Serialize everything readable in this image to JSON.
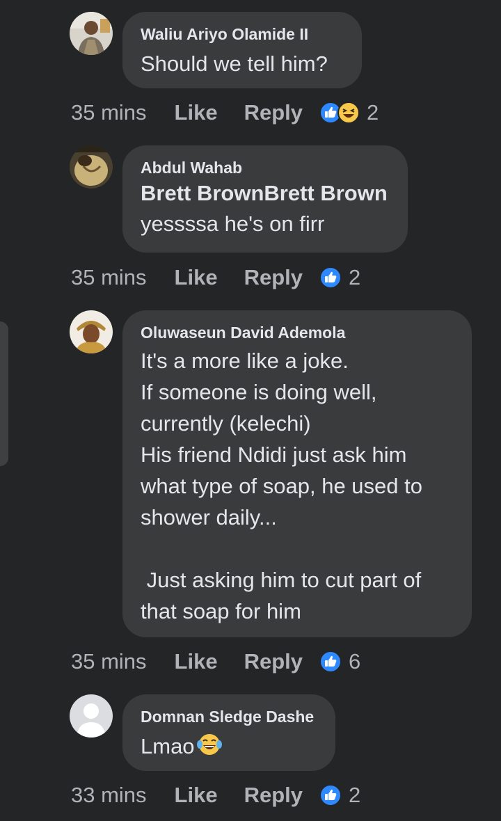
{
  "colors": {
    "background": "#242526",
    "bubble": "#3a3b3c",
    "text": "#e4e6eb",
    "secondary_text": "#b0b3b8",
    "like_blue": "#2e89ff"
  },
  "comments": [
    {
      "author": "Waliu Ariyo Olamide II",
      "text": "Should we tell him?",
      "time": "35 mins",
      "like_label": "Like",
      "reply_label": "Reply",
      "reactions": [
        "like-icon",
        "haha-icon"
      ],
      "reaction_count": "2"
    },
    {
      "author": "Abdul Wahab",
      "tag": "Brett BrownBrett Brown",
      "text": "yessssa he's on firr",
      "time": "35 mins",
      "like_label": "Like",
      "reply_label": "Reply",
      "reactions": [
        "like-icon"
      ],
      "reaction_count": "2"
    },
    {
      "author": "Oluwaseun David Ademola",
      "text": "It's a more like a joke.\nIf someone is doing well,\ncurrently (kelechi)\nHis friend Ndidi just ask him\nwhat type of soap, he used to\nshower daily...\n\n Just asking him to cut part of\nthat soap for him",
      "time": "35 mins",
      "like_label": "Like",
      "reply_label": "Reply",
      "reactions": [
        "like-icon"
      ],
      "reaction_count": "6"
    },
    {
      "author": "Domnan Sledge Dashe",
      "text": "Lmao",
      "text_emoji": "tears-of-joy-emoji",
      "time": "33 mins",
      "like_label": "Like",
      "reply_label": "Reply",
      "reactions": [
        "like-icon"
      ],
      "reaction_count": "2"
    }
  ]
}
